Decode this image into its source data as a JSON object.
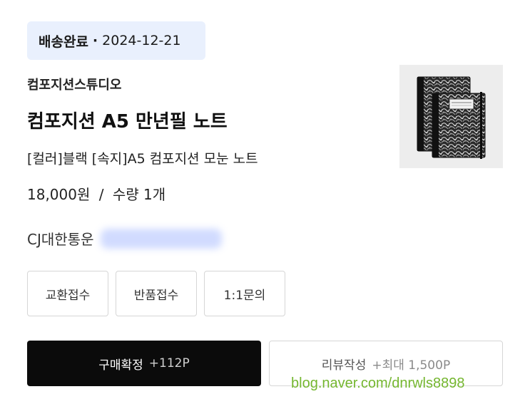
{
  "order": {
    "status": "배송완료",
    "separator": "·",
    "date": "2024-12-21"
  },
  "product": {
    "seller": "컴포지션스튜디오",
    "title": "컴포지션 A5 만년필 노트",
    "option": "[컬러]블랙 [속지]A5 컴포지션 모눈 노트",
    "price": "18,000원",
    "price_separator": "/",
    "quantity": "수량 1개",
    "thumbnail_icon": "composition-notebook-icon"
  },
  "delivery": {
    "carrier": "CJ대한통운",
    "tracking_number": ""
  },
  "actions": {
    "exchange_label": "교환접수",
    "return_label": "반품접수",
    "inquiry_label": "1:1문의"
  },
  "confirm": {
    "label": "구매확정",
    "points": "+112P"
  },
  "review": {
    "label": "리뷰작성",
    "points": "+최대 1,500P"
  },
  "watermark": "blog.naver.com/dnrwls8898",
  "colors": {
    "status_bg": "#e9f0fd",
    "primary_button": "#0b0b0b",
    "watermark": "#74b62f"
  }
}
